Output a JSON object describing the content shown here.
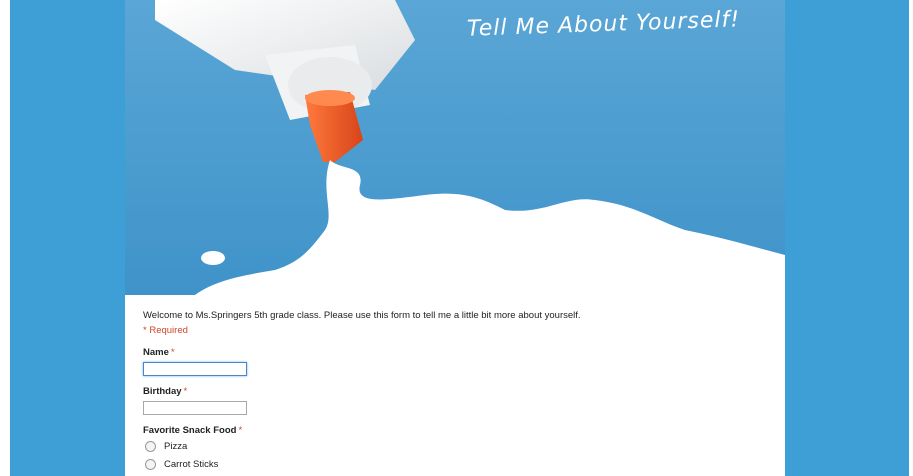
{
  "header": {
    "title": "Tell Me About Yourself!"
  },
  "form": {
    "intro": "Welcome to Ms.Springers 5th grade class. Please use this form to tell me a little bit more about yourself.",
    "required_note": "* Required",
    "fields": {
      "name": {
        "label": "Name",
        "required_mark": "*",
        "value": ""
      },
      "birthday": {
        "label": "Birthday",
        "required_mark": "*",
        "value": ""
      },
      "snack": {
        "label": "Favorite Snack Food",
        "required_mark": "*",
        "options": [
          "Pizza",
          "Carrot Sticks"
        ]
      }
    }
  },
  "colors": {
    "background": "#3d9fd6",
    "header_blue": "#4a9cd0",
    "required_red": "#d0452b",
    "cap_orange": "#ef5a24"
  },
  "icons": [
    "glue-bottle-illustration"
  ]
}
